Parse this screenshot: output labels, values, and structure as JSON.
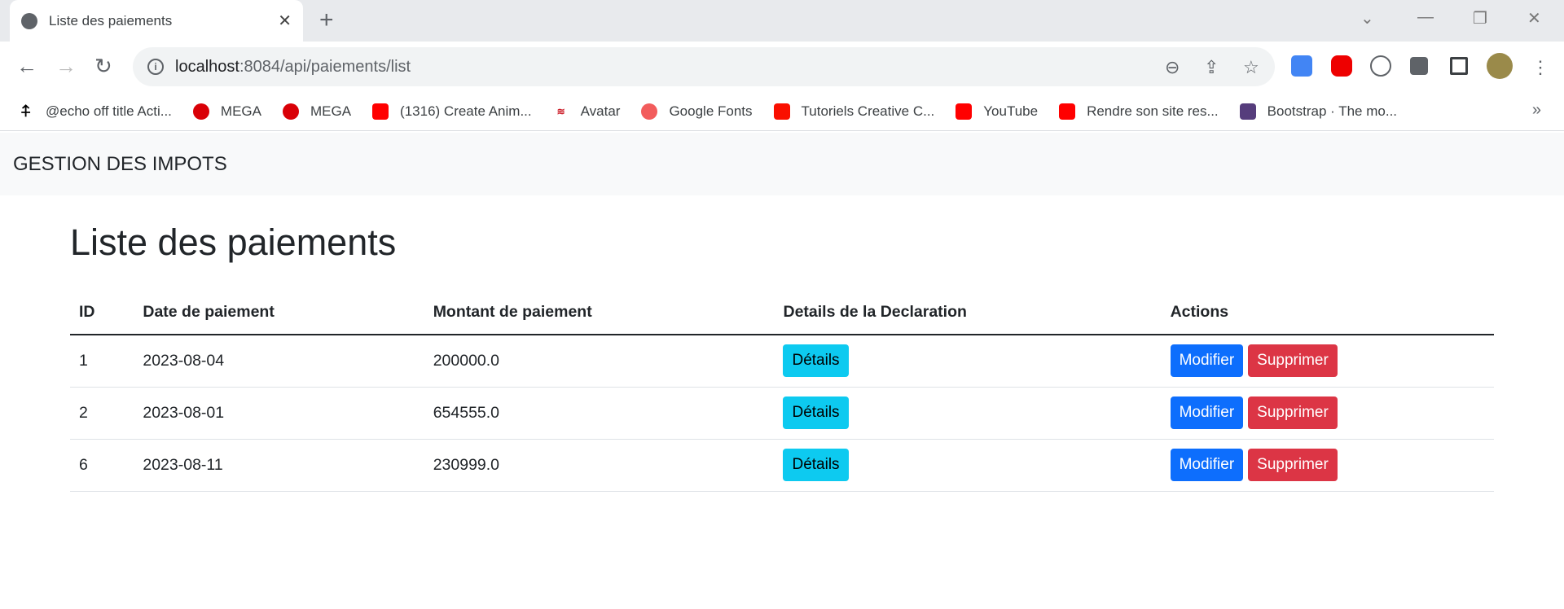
{
  "browser": {
    "tab_title": "Liste des paiements",
    "url_host": "localhost",
    "url_path": ":8084/api/paiements/list",
    "bookmarks": [
      {
        "label": "@echo off title Acti...",
        "icon": "arrow-up-icon",
        "color": "#000000"
      },
      {
        "label": "MEGA",
        "icon": "mega-icon",
        "color": "#d90007"
      },
      {
        "label": "MEGA",
        "icon": "mega-icon",
        "color": "#d90007"
      },
      {
        "label": "(1316) Create Anim...",
        "icon": "youtube-icon",
        "color": "#ff0000"
      },
      {
        "label": "Avatar",
        "icon": "avatar-logo-icon",
        "color": "#cc1f2a"
      },
      {
        "label": "Google Fonts",
        "icon": "google-fonts-icon",
        "color": "#f25c5c"
      },
      {
        "label": "Tutoriels Creative C...",
        "icon": "adobe-icon",
        "color": "#fa0f00"
      },
      {
        "label": "YouTube",
        "icon": "youtube-icon",
        "color": "#ff0000"
      },
      {
        "label": "Rendre son site res...",
        "icon": "youtube-icon",
        "color": "#ff0000"
      },
      {
        "label": "Bootstrap · The mo...",
        "icon": "bootstrap-icon",
        "color": "#563d7c"
      }
    ]
  },
  "app": {
    "brand": "GESTION DES IMPOTS",
    "page_title": "Liste des paiements",
    "table": {
      "headers": [
        "ID",
        "Date de paiement",
        "Montant de paiement",
        "Details de la Declaration",
        "Actions"
      ],
      "rows": [
        {
          "id": "1",
          "date": "2023-08-04",
          "montant": "200000.0"
        },
        {
          "id": "2",
          "date": "2023-08-01",
          "montant": "654555.0"
        },
        {
          "id": "6",
          "date": "2023-08-11",
          "montant": "230999.0"
        }
      ],
      "details_label": "Détails",
      "edit_label": "Modifier",
      "delete_label": "Supprimer"
    },
    "colors": {
      "info": "#0dcaf0",
      "primary": "#0d6efd",
      "danger": "#dc3545"
    }
  }
}
